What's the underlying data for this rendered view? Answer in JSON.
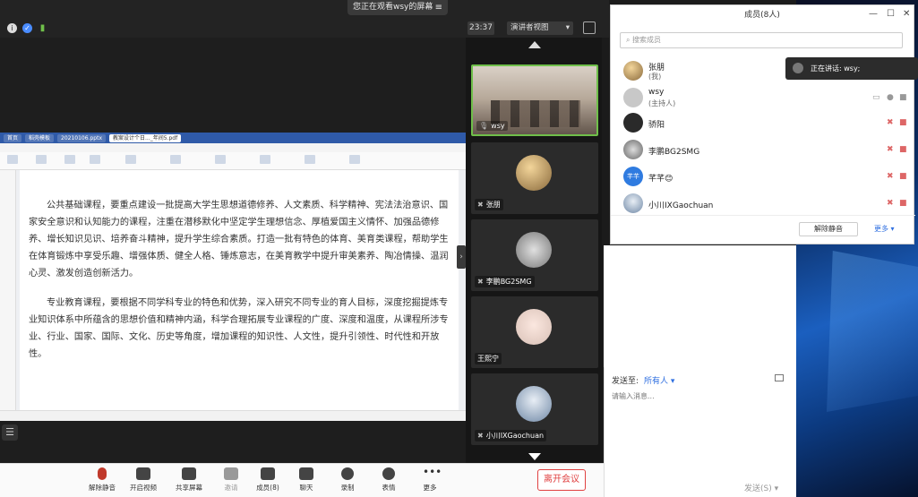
{
  "topbar": {
    "watch_banner": "您正在观看wsy的屏幕",
    "timer": "23:37",
    "view_mode": "演讲者视图"
  },
  "doc": {
    "tabs": [
      "首页",
      "稻壳模板",
      "20210106.pptx",
      "教案设计个日..._年间5.pdf"
    ],
    "paragraphs": [
      "公共基础课程，要重点建设一批提高大学生思想道德修养、人文素质、科学精神、宪法法治意识、国家安全意识和认知能力的课程，注重在潜移默化中坚定学生理想信念、厚植爱国主义情怀、加强品德修养、增长知识见识、培养奋斗精神，提升学生综合素质。打造一批有特色的体育、美育类课程，帮助学生在体育锻炼中享受乐趣、增强体质、健全人格、锤炼意志，在美育教学中提升审美素养、陶冶情操、温润心灵、激发创造创新活力。",
      "专业教育课程，要根据不同学科专业的特色和优势，深入研究不同专业的育人目标，深度挖掘提炼专业知识体系中所蕴含的思想价值和精神内涵，科学合理拓展专业课程的广度、深度和温度，从课程所涉专业、行业、国家、国际、文化、历史等角度，增加课程的知识性、人文性，提升引领性、时代性和开放性。"
    ]
  },
  "tiles": [
    {
      "name": "wsy",
      "kind": "video"
    },
    {
      "name": "张朋",
      "kind": "avatar",
      "color": "#c9a97a"
    },
    {
      "name": "李鹏BG2SMG",
      "kind": "avatar",
      "color": "#d0d0d0"
    },
    {
      "name": "王熙宁",
      "kind": "avatar",
      "color": "#f0d7cf"
    },
    {
      "name": "小川IXGaochuan",
      "kind": "avatar",
      "color": "#9fb3c8"
    }
  ],
  "toolbar": {
    "items": [
      "解除静音",
      "开启视频",
      "共享屏幕",
      "邀请",
      "成员(8)",
      "聊天",
      "录制",
      "表情",
      "更多"
    ],
    "leave": "离开会议"
  },
  "members": {
    "title": "成员(8人)",
    "search_placeholder": "搜索成员",
    "list": [
      {
        "name": "张朋",
        "sub": "(我)",
        "color": "#c9a97a"
      },
      {
        "name": "wsy",
        "sub": "(主持人)",
        "color": "#b0b0b0"
      },
      {
        "name": "骄阳",
        "sub": "",
        "color": "#2a2a2a"
      },
      {
        "name": "李鹏BG2SMG",
        "sub": "",
        "color": "#8a8a8a"
      },
      {
        "name": "芊芊😊",
        "sub": "",
        "color": "#2f7be0",
        "initials": "芊芊"
      },
      {
        "name": "小川IXGaochuan",
        "sub": "",
        "color": "#9fb3c8"
      }
    ],
    "unmute_all": "解除静音",
    "more": "更多"
  },
  "speaking": {
    "label": "正在讲话: wsy;"
  },
  "chat": {
    "send_to_label": "发送至:",
    "send_to_target": "所有人",
    "input_placeholder": "请输入消息...",
    "send": "发送(S)"
  }
}
